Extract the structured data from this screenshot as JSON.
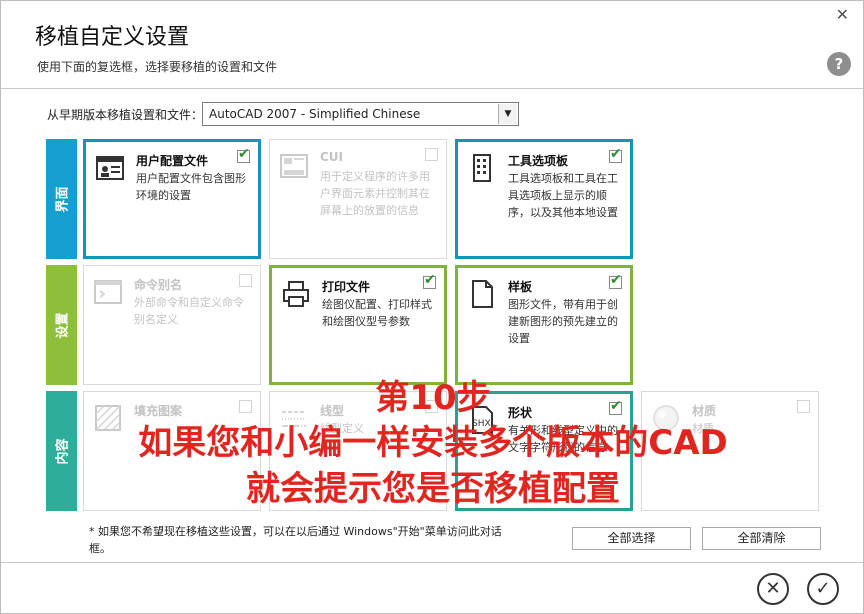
{
  "dialog": {
    "title": "移植自定义设置",
    "subtitle": "使用下面的复选框，选择要移植的设置和文件",
    "help_glyph": "?",
    "close_glyph": "✕"
  },
  "version": {
    "label": "从早期版本移植设置和文件：",
    "selected": "AutoCAD 2007 - Simplified Chinese"
  },
  "categories": {
    "interface": "界面",
    "settings": "设置",
    "content": "内容"
  },
  "cards": [
    {
      "id": "user-profile",
      "title": "用户配置文件",
      "desc": "用户配置文件包含图形环境的设置",
      "checked": true,
      "enabled": true,
      "icon": "profile-icon"
    },
    {
      "id": "cui",
      "title": "CUI",
      "desc": "用于定义程序的许多用户界面元素并控制其在屏幕上的放置的信息",
      "checked": false,
      "enabled": false,
      "icon": "cui-icon"
    },
    {
      "id": "tool-palettes",
      "title": "工具选项板",
      "desc": "工具选项板和工具在工具选项板上显示的顺序，以及其他本地设置",
      "checked": true,
      "enabled": true,
      "icon": "palette-icon"
    },
    {
      "id": "command-alias",
      "title": "命令别名",
      "desc": "外部命令和自定义命令别名定义",
      "checked": false,
      "enabled": false,
      "icon": "alias-icon"
    },
    {
      "id": "plot-files",
      "title": "打印文件",
      "desc": "绘图仪配置、打印样式和绘图仪型号参数",
      "checked": true,
      "enabled": true,
      "icon": "printer-icon"
    },
    {
      "id": "templates",
      "title": "样板",
      "desc": "图形文件，带有用于创建新图形的预先建立的设置",
      "checked": true,
      "enabled": true,
      "icon": "template-icon"
    },
    {
      "id": "hatch",
      "title": "填充图案",
      "desc": "",
      "checked": false,
      "enabled": false,
      "icon": "hatch-icon"
    },
    {
      "id": "linetype",
      "title": "线型",
      "desc": "线型定义",
      "checked": false,
      "enabled": false,
      "icon": "linetype-icon"
    },
    {
      "id": "shapes",
      "title": "形状",
      "desc": "有关形和线型定义中的文字字符形状的信息",
      "checked": true,
      "enabled": true,
      "icon": "shx-icon"
    },
    {
      "id": "materials",
      "title": "材质",
      "desc": "材质",
      "checked": false,
      "enabled": false,
      "icon": "material-icon"
    }
  ],
  "note": "* 如果您不希望现在移植这些设置，可以在以后通过 Windows\"开始\"菜单访问此对话框。",
  "buttons": {
    "select_all": "全部选择",
    "clear_all": "全部清除"
  },
  "icons": {
    "cancel": "✕",
    "ok": "✓",
    "checkmark": "✔"
  },
  "overlay": {
    "line1": "第10步",
    "line2": "如果您和小编一样安装多个版本的CAD",
    "line3": "就会提示您是否移植配置"
  },
  "colors": {
    "interface": "#159ed0",
    "settings": "#8dbf3b",
    "content": "#2eae9a",
    "overlay": "#e0261e"
  }
}
